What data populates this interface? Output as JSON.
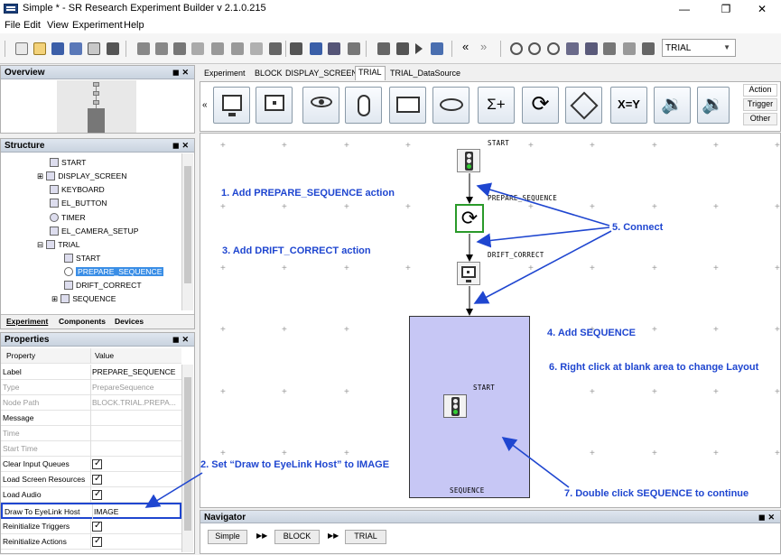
{
  "window": {
    "title": "Simple * - SR Research Experiment Builder v 2.1.0.215",
    "minimize": "—",
    "maximize": "❐",
    "close": "✕"
  },
  "menu": [
    "File",
    "Edit",
    "View",
    "Experiment",
    "Help"
  ],
  "toolbar": {
    "dropdown_value": "TRIAL"
  },
  "overview": {
    "title": "Overview"
  },
  "structure": {
    "title": "Structure",
    "items": [
      {
        "label": "START",
        "icon": "traffic-light-icon"
      },
      {
        "label": "DISPLAY_SCREEN",
        "icon": "monitor-icon"
      },
      {
        "label": "KEYBOARD",
        "icon": "keyboard-icon"
      },
      {
        "label": "EL_BUTTON",
        "icon": "button-box-icon"
      },
      {
        "label": "TIMER",
        "icon": "timer-icon"
      },
      {
        "label": "EL_CAMERA_SETUP",
        "icon": "camera-icon"
      },
      {
        "label": "TRIAL",
        "icon": "sequence-icon"
      },
      {
        "label": "START",
        "icon": "traffic-light-icon"
      },
      {
        "label": "PREPARE_SEQUENCE",
        "icon": "refresh-icon"
      },
      {
        "label": "DRIFT_CORRECT",
        "icon": "drift-correct-icon"
      },
      {
        "label": "SEQUENCE",
        "icon": "sequence-icon"
      }
    ],
    "tabs": [
      "Experiment",
      "Components",
      "Devices"
    ]
  },
  "properties": {
    "title": "Properties",
    "col_property": "Property",
    "col_value": "Value",
    "rows": [
      {
        "k": "Label",
        "v": "PREPARE_SEQUENCE"
      },
      {
        "k": "Type",
        "v": "PrepareSequence"
      },
      {
        "k": "Node Path",
        "v": "BLOCK.TRIAL.PREPA..."
      },
      {
        "k": "Message",
        "v": ""
      },
      {
        "k": "Time",
        "v": ""
      },
      {
        "k": "Start Time",
        "v": ""
      },
      {
        "k": "Clear Input Queues",
        "v": ""
      },
      {
        "k": "Load Screen Resources",
        "v": ""
      },
      {
        "k": "Load Audio",
        "v": ""
      },
      {
        "k": "Draw To EyeLink Host",
        "v": "IMAGE"
      },
      {
        "k": "Reinitialize Triggers",
        "v": ""
      },
      {
        "k": "Reinitialize Actions",
        "v": ""
      }
    ]
  },
  "editor_tabs": [
    "Experiment",
    "BLOCK",
    "DISPLAY_SCREEN",
    "TRIAL",
    "TRIAL_DataSource"
  ],
  "actions": {
    "scroll_left": "«",
    "x_eq_y": "X=Y"
  },
  "side_tabs": [
    "Action",
    "Trigger",
    "Other"
  ],
  "canvas": {
    "node_start": "START",
    "node_prepare": "PREPARE_SEQUENCE",
    "node_drift": "DRIFT_CORRECT",
    "seq_start": "START",
    "seq_label": "SEQUENCE"
  },
  "annotations": {
    "a1": "1. Add PREPARE_SEQUENCE action",
    "a2": "2. Set “Draw to EyeLink Host” to IMAGE",
    "a3": "3. Add DRIFT_CORRECT action",
    "a4": "4. Add SEQUENCE",
    "a5": "5. Connect",
    "a6": "6. Right click at blank area to change Layout",
    "a7": "7. Double click SEQUENCE to continue"
  },
  "navigator": {
    "title": "Navigator",
    "crumbs": [
      "Simple",
      "BLOCK",
      "TRIAL"
    ],
    "sep": "▶▶"
  },
  "colors": {
    "annotation": "#1f46d0",
    "sequence_fill": "#c7c7f5",
    "selection": "#3a8ee6"
  }
}
